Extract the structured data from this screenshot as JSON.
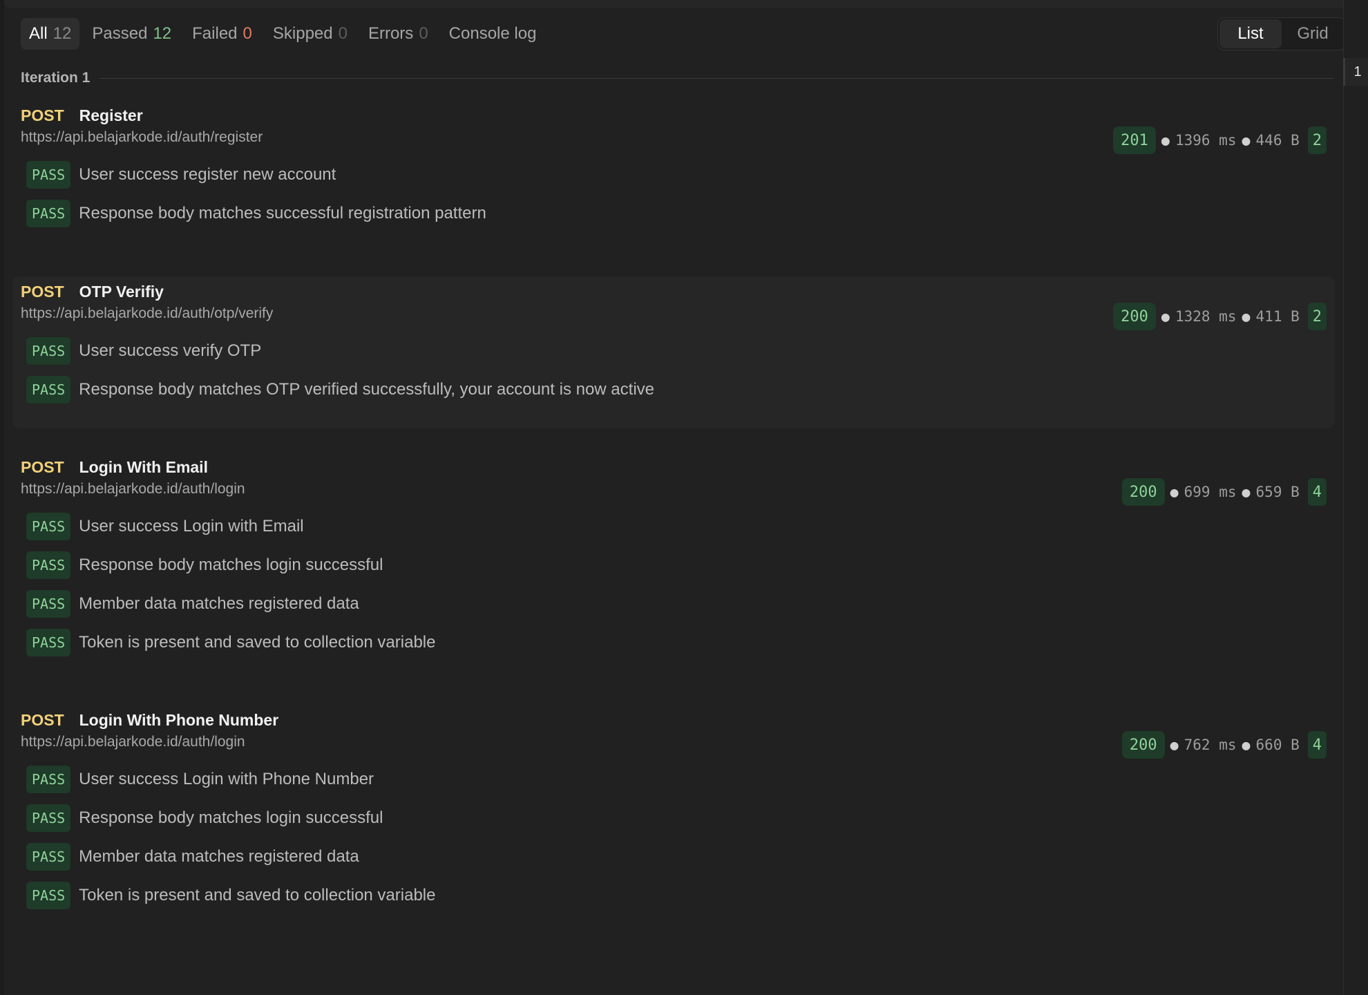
{
  "filters": [
    {
      "label": "All",
      "count": "12",
      "countStyle": "plain",
      "active": true
    },
    {
      "label": "Passed",
      "count": "12",
      "countStyle": "green",
      "active": false
    },
    {
      "label": "Failed",
      "count": "0",
      "countStyle": "red",
      "active": false
    },
    {
      "label": "Skipped",
      "count": "0",
      "countStyle": "dim",
      "active": false
    },
    {
      "label": "Errors",
      "count": "0",
      "countStyle": "dim",
      "active": false
    },
    {
      "label": "Console log",
      "count": "",
      "countStyle": "plain",
      "active": false
    }
  ],
  "view_toggle": {
    "list": "List",
    "grid": "Grid",
    "selected": "List"
  },
  "iteration": {
    "label": "Iteration 1",
    "marker": "1"
  },
  "requests": [
    {
      "method": "POST",
      "name": "Register",
      "url": "https://api.belajarkode.id/auth/register",
      "status": "201",
      "time": "1396 ms",
      "size": "446 B",
      "test_count": "2",
      "highlighted": false,
      "tests": [
        {
          "result": "PASS",
          "name": "User success register new account"
        },
        {
          "result": "PASS",
          "name": "Response body matches successful registration pattern"
        }
      ]
    },
    {
      "method": "POST",
      "name": "OTP Verifiy",
      "url": "https://api.belajarkode.id/auth/otp/verify",
      "status": "200",
      "time": "1328 ms",
      "size": "411 B",
      "test_count": "2",
      "highlighted": true,
      "tests": [
        {
          "result": "PASS",
          "name": "User success verify OTP"
        },
        {
          "result": "PASS",
          "name": "Response body matches OTP verified successfully, your account is now active"
        }
      ]
    },
    {
      "method": "POST",
      "name": "Login With Email",
      "url": "https://api.belajarkode.id/auth/login",
      "status": "200",
      "time": "699 ms",
      "size": "659 B",
      "test_count": "4",
      "highlighted": false,
      "tests": [
        {
          "result": "PASS",
          "name": "User success Login with Email"
        },
        {
          "result": "PASS",
          "name": "Response body matches login successful"
        },
        {
          "result": "PASS",
          "name": "Member data matches registered data"
        },
        {
          "result": "PASS",
          "name": "Token is present and saved to collection variable"
        }
      ]
    },
    {
      "method": "POST",
      "name": "Login With Phone Number",
      "url": "https://api.belajarkode.id/auth/login",
      "status": "200",
      "time": "762 ms",
      "size": "660 B",
      "test_count": "4",
      "highlighted": false,
      "tests": [
        {
          "result": "PASS",
          "name": "User success Login with Phone Number"
        },
        {
          "result": "PASS",
          "name": "Response body matches login successful"
        },
        {
          "result": "PASS",
          "name": "Member data matches registered data"
        },
        {
          "result": "PASS",
          "name": "Token is present and saved to collection variable"
        }
      ]
    }
  ]
}
